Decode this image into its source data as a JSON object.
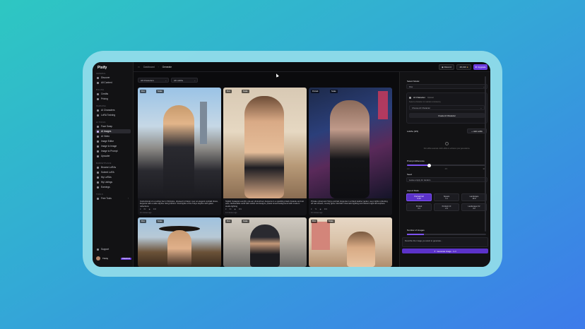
{
  "app": {
    "name": "Pixify"
  },
  "sidebar": {
    "sections": [
      {
        "title": "GENERAL",
        "items": [
          {
            "label": "Discover"
          },
          {
            "label": "All Content"
          }
        ]
      },
      {
        "title": "BILLING",
        "items": [
          {
            "label": "Credits"
          },
          {
            "label": "Pricing"
          }
        ]
      },
      {
        "title": "PERSONA",
        "items": [
          {
            "label": "AI Characters"
          },
          {
            "label": "LoRA Training"
          }
        ]
      },
      {
        "title": "AI TOOLS",
        "items": [
          {
            "label": "Face Swap"
          },
          {
            "label": "AI Images"
          },
          {
            "label": "AI Video"
          },
          {
            "label": "Image Editor"
          },
          {
            "label": "Image to Image"
          },
          {
            "label": "Image to Prompt"
          },
          {
            "label": "Upscaler"
          }
        ]
      },
      {
        "title": "MARKETPLACE",
        "items": [
          {
            "label": "Browse LoRAs"
          },
          {
            "label": "Submit LoRA"
          },
          {
            "label": "My LoRAs"
          },
          {
            "label": "My Listings"
          },
          {
            "label": "Earnings"
          }
        ]
      },
      {
        "title": "TOOLS",
        "items": [
          {
            "label": "Free Tools"
          }
        ]
      }
    ],
    "active_item": "AI Images",
    "support": "Support",
    "user": {
      "name": "Trinity",
      "badge": "PREMIUM"
    }
  },
  "topbar": {
    "breadcrumb": [
      "Dashboard",
      "Generate"
    ],
    "discord_label": "Discord",
    "credits_label": "48,196",
    "upgrade_label": "Upgrade"
  },
  "filters": {
    "character": "All Characters",
    "lora": "All LoRAs"
  },
  "cards": [
    {
      "model": "Flux",
      "badge": "Scale",
      "caption": "Instructional of a rooftop bar in Shinjuku, dressed in blazer over an elegant cocktail dress, Evgenia with a wide skyline rising behind. Vivid lights of the Tokyo skyline with glass reflections",
      "likes": "82",
      "views": "340",
      "time": "10 minutes ago"
    },
    {
      "model": "Flux",
      "badge": "Scale",
      "caption": "Stylish Instagram-worthy cat-ear photoshoot, Evgenia in a sparkling black bralette and cat ears, fashionable outfit with subtle cat designs, pastel toned background with modern studio lighting",
      "likes": "64",
      "views": "281",
      "time": "14 minutes ago"
    },
    {
      "model": "Portrait",
      "badge": "Scale",
      "caption": "Private cyberpunk Tokyo portrait, Evgenia in a black leather jacket, neon lights reflecting off wet streets, moody glow, futuristic cinematic lighting and vibrant night atmosphere",
      "likes": "71",
      "views": "302",
      "time": "16 minutes ago"
    },
    {
      "model": "Flux",
      "badge": "Scale",
      "caption": "",
      "likes": "",
      "views": "",
      "time": ""
    },
    {
      "model": "Flux",
      "badge": "Scale",
      "caption": "",
      "likes": "",
      "views": "",
      "time": ""
    },
    {
      "model": "Flux",
      "badge": "Scale",
      "caption": "",
      "likes": "",
      "views": "",
      "time": ""
    }
  ],
  "right_panel": {
    "model_label": "Select Model",
    "model_value": "Flux",
    "ai_character_label": "AI Character",
    "ai_character_tag": "Optional",
    "ai_character_hint": "Select a character to maintain consistency",
    "choose_character": "Choose AI Character",
    "create_character": "Create AI Character",
    "lora_label": "LoRAs (0/3)",
    "add_lora": "Add LoRA",
    "lora_empty": "No LoRAs selected. Add LoRAs to enhance your generations.",
    "prompt_adherence_label": "Prompt Adherence",
    "prompt_adherence_value": 0.28,
    "adherence_ticks": [
      "1.0",
      "3.5",
      "10.0"
    ],
    "seed_label": "Seed",
    "seed_placeholder": "Leave empty for random",
    "aspect_label": "Aspect Ratio",
    "ratios": [
      {
        "name": "Portrait Full",
        "ratio": "9:16"
      },
      {
        "name": "Square",
        "ratio": "1:1"
      },
      {
        "name": "Landscape",
        "ratio": "16:9"
      },
      {
        "name": "Portrait",
        "ratio": "3:4"
      },
      {
        "name": "Portrait 2:3",
        "ratio": "2:3"
      },
      {
        "name": "Landscape 3:2",
        "ratio": "3:2"
      }
    ],
    "selected_ratio": "Portrait Full",
    "num_images_label": "Number of Images",
    "prompt_placeholder": "Describe the image you want to generate...",
    "generate_label": "Generate Image  · 1 cr"
  },
  "colors": {
    "accent": "#6c3ce0",
    "bg": "#0b0b0d",
    "panel": "#121214"
  }
}
